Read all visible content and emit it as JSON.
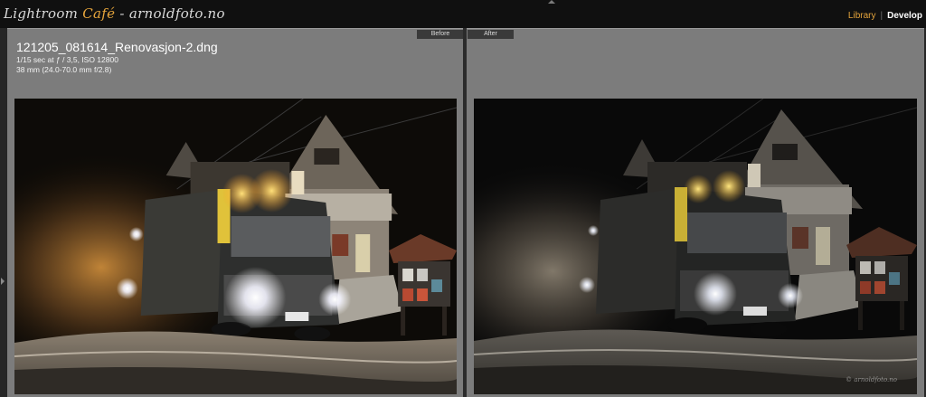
{
  "app": {
    "brand_prefix": "Lightroom ",
    "brand_highlight": "Café",
    "brand_suffix": " - arnoldfoto.no"
  },
  "modules": {
    "library": "Library",
    "develop": "Develop",
    "active": "Develop",
    "accent_color": "#e6a53c"
  },
  "photo_info": {
    "filename": "121205_081614_Renovasjon-2.dng",
    "exposure": "1/15 sec at ƒ / 3,5, ISO 12800",
    "lens": "38 mm (24.0-70.0 mm f/2.8)"
  },
  "compare": {
    "before_label": "Before",
    "after_label": "After"
  },
  "watermark": "© arnoldfoto.no",
  "icons": {
    "top_panel_toggle": "triangle-up-icon",
    "left_panel_toggle": "triangle-right-icon"
  }
}
